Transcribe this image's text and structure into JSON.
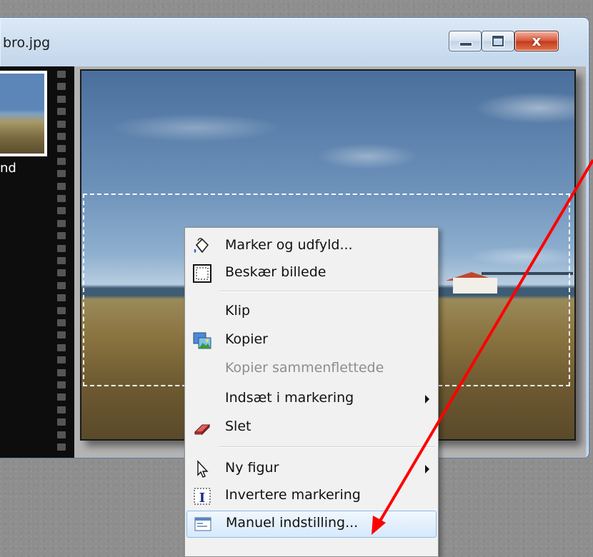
{
  "window": {
    "title": "bro.jpg",
    "minimize_icon": "minimize-icon",
    "maximize_icon": "maximize-icon",
    "close_icon": "close-icon",
    "close_glyph": "x"
  },
  "filmstrip": {
    "thumbnail_label": "nd"
  },
  "context_menu": {
    "items": [
      {
        "label": "Marker og udfyld...",
        "icon": "paint-bucket-icon",
        "enabled": true
      },
      {
        "label": "Beskær billede",
        "icon": "crop-icon",
        "enabled": true
      },
      {
        "label": "Klip",
        "icon": "",
        "enabled": true
      },
      {
        "label": "Kopier",
        "icon": "copy-image-icon",
        "enabled": true
      },
      {
        "label": "Kopier sammenflettede",
        "icon": "",
        "enabled": false
      },
      {
        "label": "Indsæt i markering",
        "icon": "",
        "enabled": true,
        "submenu": true
      },
      {
        "label": "Slet",
        "icon": "eraser-icon",
        "enabled": true
      },
      {
        "label": "Ny figur",
        "icon": "pointer-icon",
        "enabled": true,
        "submenu": true
      },
      {
        "label": "Invertere markering",
        "icon": "invert-selection-icon",
        "enabled": true
      },
      {
        "label": "Manuel indstilling...",
        "icon": "window-settings-icon",
        "enabled": true,
        "highlighted": true
      }
    ]
  },
  "annotation": {
    "arrow_color": "#ff0000",
    "arrow_icon": "red-arrow-annotation"
  }
}
